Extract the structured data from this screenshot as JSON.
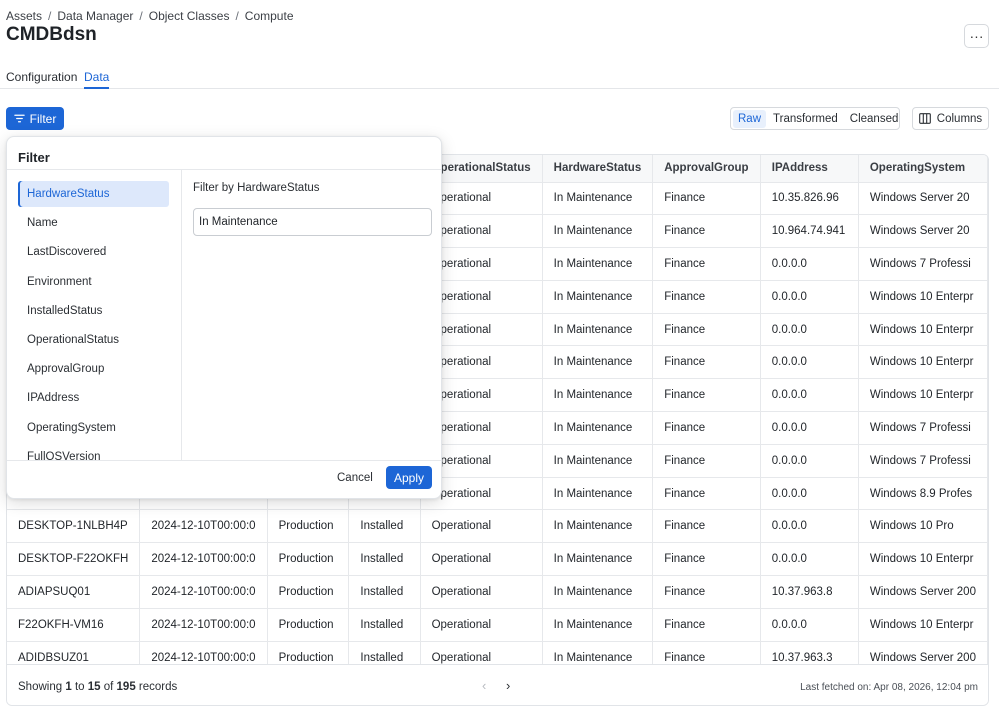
{
  "breadcrumb": [
    "Assets",
    "Data Manager",
    "Object Classes",
    "Compute"
  ],
  "breadcrumb_separator": "/",
  "page_title": "CMDBdsn",
  "more_label": "···",
  "tabs": [
    {
      "label": "Configuration"
    },
    {
      "label": "Data",
      "active": true
    }
  ],
  "toolbar": {
    "filter_label": "Filter",
    "views": [
      {
        "label": "Raw",
        "active": true
      },
      {
        "label": "Transformed"
      },
      {
        "label": "Cleansed"
      }
    ],
    "columns_label": "Columns"
  },
  "table": {
    "columns": [
      "",
      "",
      "",
      "",
      "OperationalStatus",
      "HardwareStatus",
      "ApprovalGroup",
      "IPAddress",
      "OperatingSystem"
    ],
    "rows": [
      [
        "",
        "",
        "",
        "",
        "Operational",
        "In Maintenance",
        "Finance",
        "10.35.826.96",
        "Windows Server 20"
      ],
      [
        "",
        "",
        "",
        "",
        "Operational",
        "In Maintenance",
        "Finance",
        "10.964.74.941",
        "Windows Server 20"
      ],
      [
        "",
        "",
        "",
        "",
        "Operational",
        "In Maintenance",
        "Finance",
        "0.0.0.0",
        "Windows 7 Professi"
      ],
      [
        "",
        "",
        "",
        "",
        "Operational",
        "In Maintenance",
        "Finance",
        "0.0.0.0",
        "Windows 10 Enterpr"
      ],
      [
        "",
        "",
        "",
        "",
        "Operational",
        "In Maintenance",
        "Finance",
        "0.0.0.0",
        "Windows 10 Enterpr"
      ],
      [
        "",
        "",
        "",
        "",
        "Operational",
        "In Maintenance",
        "Finance",
        "0.0.0.0",
        "Windows 10 Enterpr"
      ],
      [
        "",
        "",
        "",
        "",
        "Operational",
        "In Maintenance",
        "Finance",
        "0.0.0.0",
        "Windows 10 Enterpr"
      ],
      [
        "",
        "",
        "",
        "",
        "Operational",
        "In Maintenance",
        "Finance",
        "0.0.0.0",
        "Windows 7 Professi"
      ],
      [
        "",
        "",
        "",
        "",
        "Operational",
        "In Maintenance",
        "Finance",
        "0.0.0.0",
        "Windows 7 Professi"
      ],
      [
        "",
        "",
        "",
        "",
        "Operational",
        "In Maintenance",
        "Finance",
        "0.0.0.0",
        "Windows 8.9 Profes"
      ],
      [
        "DESKTOP-1NLBH4P",
        "2024-12-10T00:00:0",
        "Production",
        "Installed",
        "Operational",
        "In Maintenance",
        "Finance",
        "0.0.0.0",
        "Windows 10 Pro"
      ],
      [
        "DESKTOP-F22OKFH",
        "2024-12-10T00:00:0",
        "Production",
        "Installed",
        "Operational",
        "In Maintenance",
        "Finance",
        "0.0.0.0",
        "Windows 10 Enterpr"
      ],
      [
        "ADIAPSUQ01",
        "2024-12-10T00:00:0",
        "Production",
        "Installed",
        "Operational",
        "In Maintenance",
        "Finance",
        "10.37.963.8",
        "Windows Server 200"
      ],
      [
        "F22OKFH-VM16",
        "2024-12-10T00:00:0",
        "Production",
        "Installed",
        "Operational",
        "In Maintenance",
        "Finance",
        "0.0.0.0",
        "Windows 10 Enterpr"
      ],
      [
        "ADIDBSUZ01",
        "2024-12-10T00:00:0",
        "Production",
        "Installed",
        "Operational",
        "In Maintenance",
        "Finance",
        "10.37.963.3",
        "Windows Server 200"
      ]
    ]
  },
  "footer": {
    "showing": "Showing",
    "from": "1",
    "to_word": "to",
    "to": "15",
    "of_word": "of",
    "total": "195",
    "records": "records",
    "prev": "‹",
    "next": "›",
    "fetched": "Last fetched on: Apr 08, 2026, 12:04 pm"
  },
  "filter_panel": {
    "title": "Filter",
    "fields": [
      {
        "label": "HardwareStatus",
        "active": true
      },
      {
        "label": "Name"
      },
      {
        "label": "LastDiscovered"
      },
      {
        "label": "Environment"
      },
      {
        "label": "InstalledStatus"
      },
      {
        "label": "OperationalStatus"
      },
      {
        "label": "ApprovalGroup"
      },
      {
        "label": "IPAddress"
      },
      {
        "label": "OperatingSystem"
      },
      {
        "label": "FullOSVersion"
      }
    ],
    "filter_by_label": "Filter by HardwareStatus",
    "value": "In Maintenance",
    "cancel_label": "Cancel",
    "apply_label": "Apply"
  },
  "colors": {
    "accent": "#1d66d6",
    "active_bg": "#dde8fb"
  }
}
